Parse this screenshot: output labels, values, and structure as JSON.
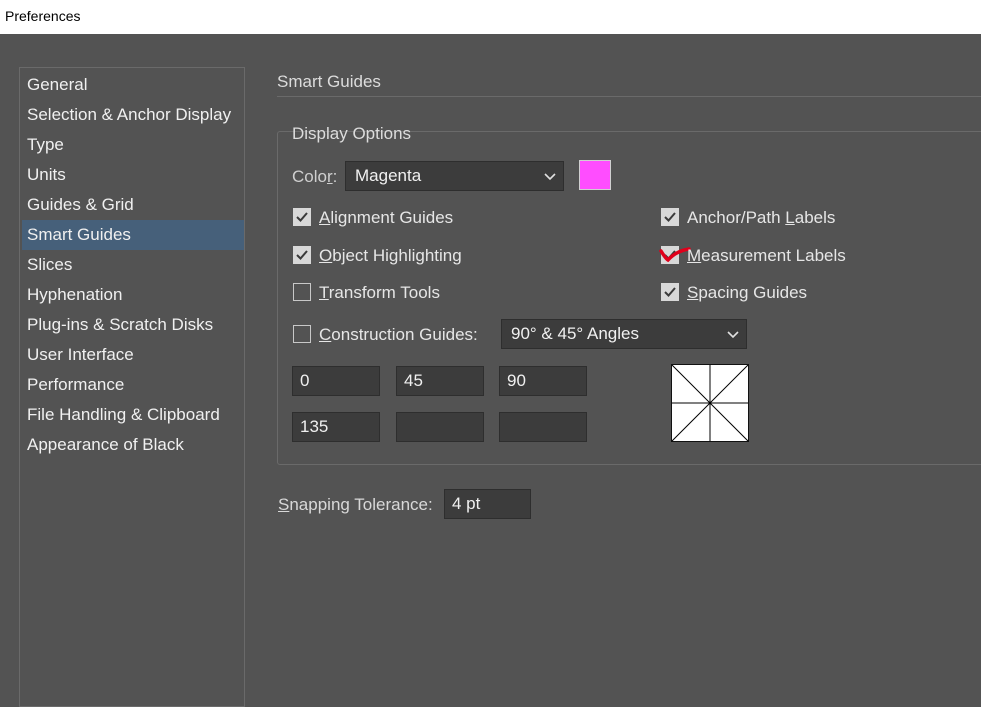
{
  "window": {
    "title": "Preferences"
  },
  "sidebar": {
    "items": [
      {
        "label": "General"
      },
      {
        "label": "Selection & Anchor Display"
      },
      {
        "label": "Type"
      },
      {
        "label": "Units"
      },
      {
        "label": "Guides & Grid"
      },
      {
        "label": "Smart Guides"
      },
      {
        "label": "Slices"
      },
      {
        "label": "Hyphenation"
      },
      {
        "label": "Plug-ins & Scratch Disks"
      },
      {
        "label": "User Interface"
      },
      {
        "label": "Performance"
      },
      {
        "label": "File Handling & Clipboard"
      },
      {
        "label": "Appearance of Black"
      }
    ],
    "active": "Smart Guides"
  },
  "panel": {
    "title": "Smart Guides",
    "display_options": {
      "title": "Display Options",
      "color_label_a": "Colo",
      "color_label_b": "r",
      "color_label_c": ":",
      "color_value": "Magenta",
      "swatch_color": "#ff4dff"
    },
    "checkboxes": {
      "alignment_a": "A",
      "alignment_b": "lignment Guides",
      "alignment_checked": true,
      "object_a": "O",
      "object_b": "bject Highlighting",
      "object_checked": true,
      "transform_a": "T",
      "transform_b": "ransform Tools",
      "transform_checked": false,
      "anchor_a": "Anchor/Path ",
      "anchor_b": "L",
      "anchor_c": "abels",
      "anchor_checked": true,
      "measurement_a": "M",
      "measurement_b": "easurement Labels",
      "measurement_checked": true,
      "spacing_a": "S",
      "spacing_b": "pacing Guides",
      "spacing_checked": true,
      "construction_a": "C",
      "construction_b": "onstruction Guides:",
      "construction_checked": false
    },
    "construction_select": "90° & 45° Angles",
    "angles": [
      "0",
      "45",
      "90",
      "135",
      "",
      ""
    ],
    "snapping": {
      "label_a": "S",
      "label_b": "napping Tolerance:",
      "value": "4 pt"
    }
  },
  "colors": {
    "accent_selected": "#46607a",
    "annotation_red": "#e0001b"
  }
}
